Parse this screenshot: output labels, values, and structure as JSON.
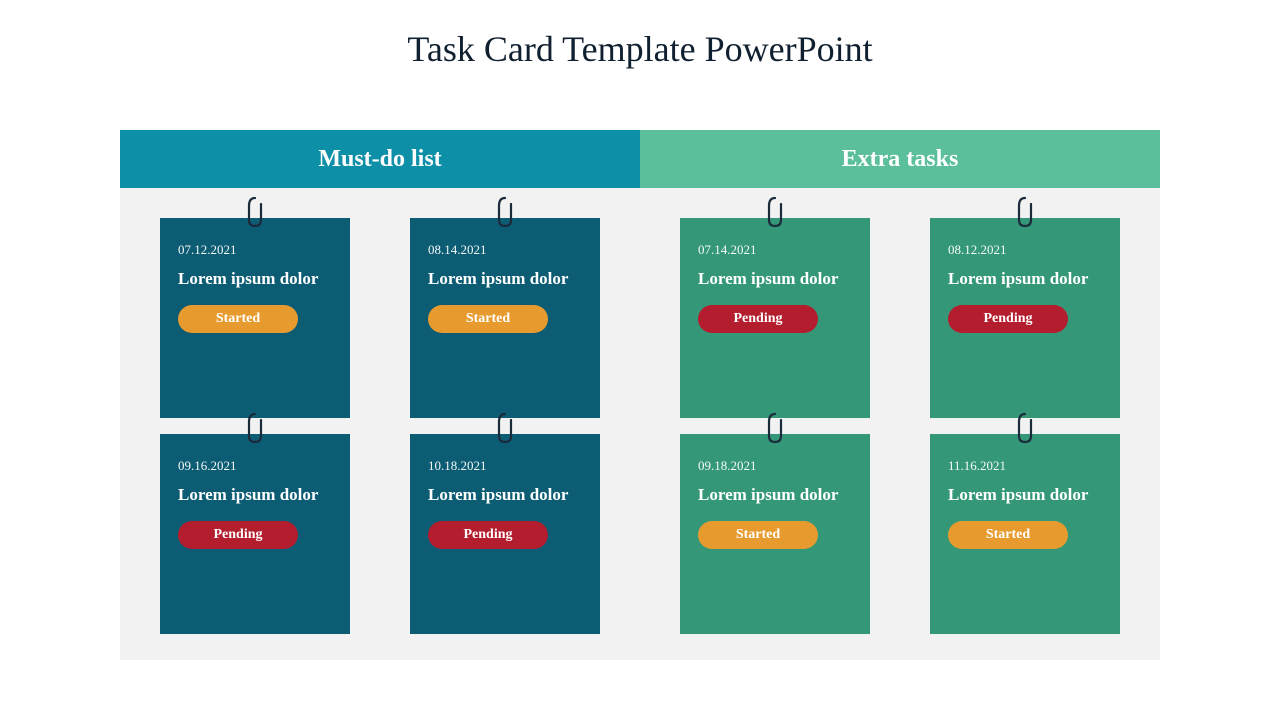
{
  "title": "Task Card Template PowerPoint",
  "columns": [
    {
      "header": "Must-do list",
      "headerClass": "teal",
      "cardClass": "teal",
      "cards": [
        {
          "date": "07.12.2021",
          "title": "Lorem ipsum dolor",
          "status": "Started",
          "statusClass": "started"
        },
        {
          "date": "08.14.2021",
          "title": "Lorem ipsum dolor",
          "status": "Started",
          "statusClass": "started"
        },
        {
          "date": "09.16.2021",
          "title": "Lorem ipsum dolor",
          "status": "Pending",
          "statusClass": "pending"
        },
        {
          "date": "10.18.2021",
          "title": "Lorem ipsum dolor",
          "status": "Pending",
          "statusClass": "pending"
        }
      ]
    },
    {
      "header": "Extra tasks",
      "headerClass": "mint",
      "cardClass": "green",
      "cards": [
        {
          "date": "07.14.2021",
          "title": "Lorem ipsum dolor",
          "status": "Pending",
          "statusClass": "pending"
        },
        {
          "date": "08.12.2021",
          "title": "Lorem ipsum dolor",
          "status": "Pending",
          "statusClass": "pending"
        },
        {
          "date": "09.18.2021",
          "title": "Lorem ipsum dolor",
          "status": "Started",
          "statusClass": "started"
        },
        {
          "date": "11.16.2021",
          "title": "Lorem ipsum dolor",
          "status": "Started",
          "statusClass": "started"
        }
      ]
    }
  ]
}
